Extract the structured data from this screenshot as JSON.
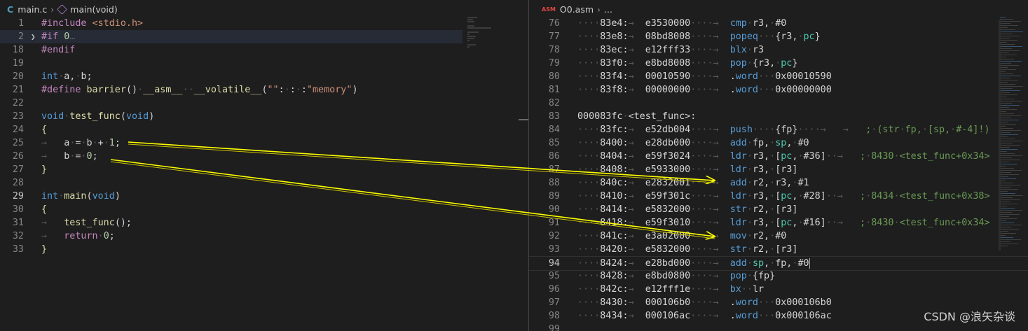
{
  "left": {
    "file_name": "main.c",
    "file_icon": "C",
    "symbol": "main(void)",
    "lines": [
      {
        "n": "1",
        "t": [
          [
            "pp",
            "#include "
          ],
          [
            "str",
            "<stdio.h>"
          ]
        ]
      },
      {
        "n": "2",
        "t": [
          [
            "pp",
            "#if "
          ],
          [
            "num",
            "0"
          ],
          [
            "dim",
            "…"
          ]
        ],
        "fold": true,
        "hl": true
      },
      {
        "n": "18",
        "t": [
          [
            "pp",
            "#endif"
          ]
        ]
      },
      {
        "n": "19",
        "t": []
      },
      {
        "n": "20",
        "t": [
          [
            "kw",
            "int"
          ],
          [
            "",
            "·a,·b;"
          ]
        ]
      },
      {
        "n": "21",
        "t": [
          [
            "pp",
            "#define "
          ],
          [
            "fn",
            "barrier"
          ],
          [
            "",
            "()·"
          ],
          [
            "fn",
            "__asm__"
          ],
          [
            "",
            "··"
          ],
          [
            "fn",
            "__volatile__"
          ],
          [
            "",
            "("
          ],
          [
            "str",
            "\"\""
          ],
          [
            "",
            ":·:·:"
          ],
          [
            "str",
            "\"memory\""
          ],
          [
            "",
            ")"
          ]
        ]
      },
      {
        "n": "22",
        "t": []
      },
      {
        "n": "23",
        "t": [
          [
            "kw",
            "void"
          ],
          [
            "",
            "·"
          ],
          [
            "fn",
            "test_func"
          ],
          [
            "",
            "("
          ],
          [
            "kw",
            "void"
          ],
          [
            "",
            ")"
          ]
        ]
      },
      {
        "n": "24",
        "t": [
          [
            "fn",
            "{"
          ]
        ]
      },
      {
        "n": "25",
        "t": [
          [
            "dim",
            "→   "
          ],
          [
            "",
            "a·=·b·+·"
          ],
          [
            "num",
            "1"
          ],
          [
            "",
            ";"
          ]
        ]
      },
      {
        "n": "26",
        "t": [
          [
            "dim",
            "→   "
          ],
          [
            "",
            "b·=·"
          ],
          [
            "num",
            "0"
          ],
          [
            "",
            ";"
          ]
        ]
      },
      {
        "n": "27",
        "t": [
          [
            "fn",
            "}"
          ]
        ]
      },
      {
        "n": "28",
        "t": []
      },
      {
        "n": "29",
        "t": [
          [
            "kw",
            "int"
          ],
          [
            "",
            "·"
          ],
          [
            "fn",
            "main"
          ],
          [
            "",
            "("
          ],
          [
            "kw",
            "void"
          ],
          [
            "",
            ")"
          ]
        ],
        "cur": true
      },
      {
        "n": "30",
        "t": [
          [
            "fn",
            "{"
          ]
        ]
      },
      {
        "n": "31",
        "t": [
          [
            "dim",
            "→   "
          ],
          [
            "fn",
            "test_func"
          ],
          [
            "",
            "();"
          ]
        ]
      },
      {
        "n": "32",
        "t": [
          [
            "dim",
            "→   "
          ],
          [
            "pp",
            "return"
          ],
          [
            "",
            "·"
          ],
          [
            "num",
            "0"
          ],
          [
            "",
            ";"
          ]
        ]
      },
      {
        "n": "33",
        "t": [
          [
            "fn",
            "}"
          ]
        ]
      }
    ]
  },
  "right": {
    "file_icon": "ASM",
    "file_name": "O0.asm",
    "crumb_more": "...",
    "lines": [
      {
        "n": "76",
        "t": [
          [
            "dim",
            "····"
          ],
          [
            "",
            "83e4:"
          ],
          [
            "dim",
            "→  "
          ],
          [
            "",
            "e3530000"
          ],
          [
            "dim",
            "····→  "
          ],
          [
            "kw",
            "cmp"
          ],
          [
            "",
            "·r3,·#0"
          ]
        ]
      },
      {
        "n": "77",
        "t": [
          [
            "dim",
            "····"
          ],
          [
            "",
            "83e8:"
          ],
          [
            "dim",
            "→  "
          ],
          [
            "",
            "08bd8008"
          ],
          [
            "dim",
            "····→  "
          ],
          [
            "kw",
            "popeq"
          ],
          [
            "",
            "···{r3,·"
          ],
          [
            "ty",
            "pc"
          ],
          [
            "",
            "}"
          ]
        ]
      },
      {
        "n": "78",
        "t": [
          [
            "dim",
            "····"
          ],
          [
            "",
            "83ec:"
          ],
          [
            "dim",
            "→  "
          ],
          [
            "",
            "e12fff33"
          ],
          [
            "dim",
            "····→  "
          ],
          [
            "kw",
            "blx"
          ],
          [
            "",
            "·r3"
          ]
        ]
      },
      {
        "n": "79",
        "t": [
          [
            "dim",
            "····"
          ],
          [
            "",
            "83f0:"
          ],
          [
            "dim",
            "→  "
          ],
          [
            "",
            "e8bd8008"
          ],
          [
            "dim",
            "····→  "
          ],
          [
            "kw",
            "pop"
          ],
          [
            "",
            "·{r3,·"
          ],
          [
            "ty",
            "pc"
          ],
          [
            "",
            "}"
          ]
        ]
      },
      {
        "n": "80",
        "t": [
          [
            "dim",
            "····"
          ],
          [
            "",
            "83f4:"
          ],
          [
            "dim",
            "→  "
          ],
          [
            "",
            "00010590"
          ],
          [
            "dim",
            "····→  "
          ],
          [
            "",
            "."
          ],
          [
            "kw",
            "word"
          ],
          [
            "",
            "···0x00010590"
          ]
        ]
      },
      {
        "n": "81",
        "t": [
          [
            "dim",
            "····"
          ],
          [
            "",
            "83f8:"
          ],
          [
            "dim",
            "→  "
          ],
          [
            "",
            "00000000"
          ],
          [
            "dim",
            "····→  "
          ],
          [
            "",
            "."
          ],
          [
            "kw",
            "word"
          ],
          [
            "",
            "···0x00000000"
          ]
        ]
      },
      {
        "n": "82",
        "t": []
      },
      {
        "n": "83",
        "t": [
          [
            "",
            "000083fc·<test_func>:"
          ]
        ]
      },
      {
        "n": "84",
        "t": [
          [
            "dim",
            "····"
          ],
          [
            "",
            "83fc:"
          ],
          [
            "dim",
            "→  "
          ],
          [
            "",
            "e52db004"
          ],
          [
            "dim",
            "····→  "
          ],
          [
            "kw",
            "push"
          ],
          [
            "",
            "····{fp}"
          ],
          [
            "dim",
            "····→   →   "
          ],
          [
            "cmt",
            ";·(str·fp,·[sp,·#-4]!)"
          ]
        ]
      },
      {
        "n": "85",
        "t": [
          [
            "dim",
            "····"
          ],
          [
            "",
            "8400:"
          ],
          [
            "dim",
            "→  "
          ],
          [
            "",
            "e28db000"
          ],
          [
            "dim",
            "····→  "
          ],
          [
            "kw",
            "add"
          ],
          [
            "",
            "·fp,·"
          ],
          [
            "ty",
            "sp"
          ],
          [
            "",
            ",·#0"
          ]
        ]
      },
      {
        "n": "86",
        "t": [
          [
            "dim",
            "····"
          ],
          [
            "",
            "8404:"
          ],
          [
            "dim",
            "→  "
          ],
          [
            "",
            "e59f3024"
          ],
          [
            "dim",
            "····→  "
          ],
          [
            "kw",
            "ldr"
          ],
          [
            "",
            "·r3,·["
          ],
          [
            "ty",
            "pc"
          ],
          [
            "",
            ",·#36]"
          ],
          [
            "dim",
            "··→   "
          ],
          [
            "cmt",
            ";·8430·<test_func+0x34>"
          ]
        ]
      },
      {
        "n": "87",
        "t": [
          [
            "dim",
            "····"
          ],
          [
            "",
            "8408:"
          ],
          [
            "dim",
            "→  "
          ],
          [
            "",
            "e5933000"
          ],
          [
            "dim",
            "····→  "
          ],
          [
            "kw",
            "ldr"
          ],
          [
            "",
            "·r3,·[r3]"
          ]
        ]
      },
      {
        "n": "88",
        "t": [
          [
            "dim",
            "····"
          ],
          [
            "",
            "840c:"
          ],
          [
            "dim",
            "→  "
          ],
          [
            "",
            "e2832001"
          ],
          [
            "dim",
            "····→  "
          ],
          [
            "kw",
            "add"
          ],
          [
            "",
            "·r2,·r3,·#1"
          ]
        ]
      },
      {
        "n": "89",
        "t": [
          [
            "dim",
            "····"
          ],
          [
            "",
            "8410:"
          ],
          [
            "dim",
            "→  "
          ],
          [
            "",
            "e59f301c"
          ],
          [
            "dim",
            "····→  "
          ],
          [
            "kw",
            "ldr"
          ],
          [
            "",
            "·r3,·["
          ],
          [
            "ty",
            "pc"
          ],
          [
            "",
            ",·#28]"
          ],
          [
            "dim",
            "··→   "
          ],
          [
            "cmt",
            ";·8434·<test_func+0x38>"
          ]
        ]
      },
      {
        "n": "90",
        "t": [
          [
            "dim",
            "····"
          ],
          [
            "",
            "8414:"
          ],
          [
            "dim",
            "→  "
          ],
          [
            "",
            "e5832000"
          ],
          [
            "dim",
            "····→  "
          ],
          [
            "kw",
            "str"
          ],
          [
            "",
            "·r2,·[r3]"
          ]
        ]
      },
      {
        "n": "91",
        "t": [
          [
            "dim",
            "····"
          ],
          [
            "",
            "8418:"
          ],
          [
            "dim",
            "→  "
          ],
          [
            "",
            "e59f3010"
          ],
          [
            "dim",
            "····→  "
          ],
          [
            "kw",
            "ldr"
          ],
          [
            "",
            "·r3,·["
          ],
          [
            "ty",
            "pc"
          ],
          [
            "",
            ",·#16]"
          ],
          [
            "dim",
            "··→   "
          ],
          [
            "cmt",
            ";·8430·<test_func+0x34>"
          ]
        ]
      },
      {
        "n": "92",
        "t": [
          [
            "dim",
            "····"
          ],
          [
            "",
            "841c:"
          ],
          [
            "dim",
            "→  "
          ],
          [
            "",
            "e3a02000"
          ],
          [
            "dim",
            "····→  "
          ],
          [
            "kw",
            "mov"
          ],
          [
            "",
            "·r2,·#0"
          ]
        ]
      },
      {
        "n": "93",
        "t": [
          [
            "dim",
            "····"
          ],
          [
            "",
            "8420:"
          ],
          [
            "dim",
            "→  "
          ],
          [
            "",
            "e5832000"
          ],
          [
            "dim",
            "····→  "
          ],
          [
            "kw",
            "str"
          ],
          [
            "",
            "·r2,·[r3]"
          ]
        ]
      },
      {
        "n": "94",
        "t": [
          [
            "dim",
            "····"
          ],
          [
            "",
            "8424:"
          ],
          [
            "dim",
            "→  "
          ],
          [
            "",
            "e28bd000"
          ],
          [
            "dim",
            "····→  "
          ],
          [
            "kw",
            "add"
          ],
          [
            "",
            "·"
          ],
          [
            "ty",
            "sp"
          ],
          [
            "",
            ",·fp,·#0"
          ]
        ],
        "cur": true
      },
      {
        "n": "95",
        "t": [
          [
            "dim",
            "····"
          ],
          [
            "",
            "8428:"
          ],
          [
            "dim",
            "→  "
          ],
          [
            "",
            "e8bd0800"
          ],
          [
            "dim",
            "····→  "
          ],
          [
            "kw",
            "pop"
          ],
          [
            "",
            "·{fp}"
          ]
        ]
      },
      {
        "n": "96",
        "t": [
          [
            "dim",
            "····"
          ],
          [
            "",
            "842c:"
          ],
          [
            "dim",
            "→  "
          ],
          [
            "",
            "e12fff1e"
          ],
          [
            "dim",
            "····→  "
          ],
          [
            "kw",
            "bx"
          ],
          [
            "",
            "··lr"
          ]
        ]
      },
      {
        "n": "97",
        "t": [
          [
            "dim",
            "····"
          ],
          [
            "",
            "8430:"
          ],
          [
            "dim",
            "→  "
          ],
          [
            "",
            "000106b0"
          ],
          [
            "dim",
            "····→  "
          ],
          [
            "",
            "."
          ],
          [
            "kw",
            "word"
          ],
          [
            "",
            "···0x000106b0"
          ]
        ]
      },
      {
        "n": "98",
        "t": [
          [
            "dim",
            "····"
          ],
          [
            "",
            "8434:"
          ],
          [
            "dim",
            "→  "
          ],
          [
            "",
            "000106ac"
          ],
          [
            "dim",
            "····→  "
          ],
          [
            "",
            "."
          ],
          [
            "kw",
            "word"
          ],
          [
            "",
            "···0x000106ac"
          ]
        ]
      },
      {
        "n": "99",
        "t": []
      }
    ]
  },
  "watermark": "CSDN @浪矢杂谈",
  "colors": {
    "background": "#1e1e1e",
    "keyword": "#569cd6",
    "preprocessor": "#c586c0",
    "string": "#ce9178",
    "number": "#b5cea8",
    "function": "#dcdcaa",
    "comment": "#6a9955",
    "annotation_arrow": "#ffff00"
  },
  "icons": [
    "c-file-icon",
    "symbol-method-icon",
    "asm-file-icon",
    "fold-chevron-icon"
  ]
}
